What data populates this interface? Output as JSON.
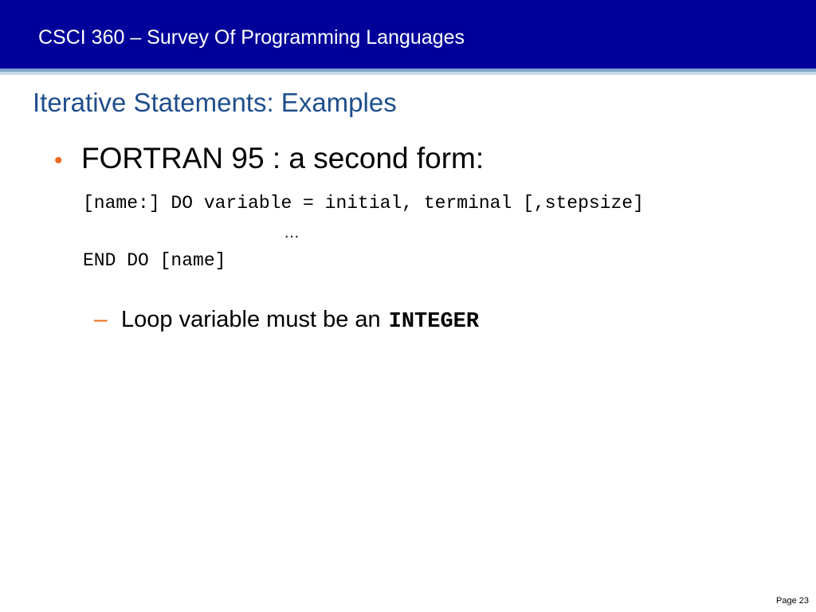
{
  "header": {
    "course_title": "CSCI 360 – Survey Of Programming Languages"
  },
  "slide": {
    "title": "Iterative Statements: Examples",
    "bullet_marker": "•",
    "bullet": "FORTRAN 95 : a second form:",
    "code": {
      "line1": "[name:] DO variable = initial, terminal [,stepsize]",
      "line2": "…",
      "line3": "END DO [name]"
    },
    "sub_bullet": {
      "marker": "–",
      "text": "Loop variable must be an",
      "keyword": "INTEGER"
    }
  },
  "footer": {
    "page_label": "Page 23"
  },
  "colors": {
    "header_bg": "#00009a",
    "title": "#1f4e8c",
    "accent": "#ec6b1e"
  }
}
